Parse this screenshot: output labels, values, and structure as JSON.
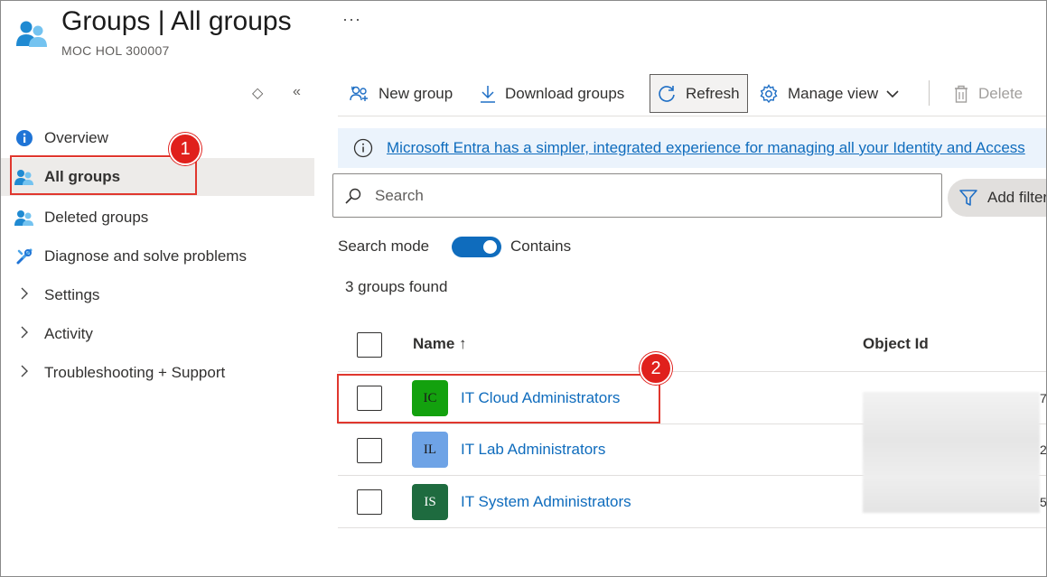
{
  "header": {
    "title": "Groups | All groups",
    "subtitle": "MOC HOL 300007",
    "more": "···",
    "icon": "groups-icon"
  },
  "sidebar": {
    "controls": {
      "expand": "◇",
      "collapse": "«"
    },
    "items": [
      {
        "label": "Overview",
        "icon": "info-icon"
      },
      {
        "label": "All groups",
        "icon": "groups-icon",
        "active": true
      },
      {
        "label": "Deleted groups",
        "icon": "groups-icon"
      },
      {
        "label": "Diagnose and solve problems",
        "icon": "wrench-icon"
      },
      {
        "label": "Settings",
        "icon": "chevron-right-icon"
      },
      {
        "label": "Activity",
        "icon": "chevron-right-icon"
      },
      {
        "label": "Troubleshooting + Support",
        "icon": "chevron-right-icon"
      }
    ]
  },
  "toolbar": {
    "new_group": "New group",
    "download_groups": "Download groups",
    "refresh": "Refresh",
    "manage_view": "Manage view",
    "delete": "Delete"
  },
  "banner": {
    "text": "Microsoft Entra has a simpler, integrated experience for managing all your Identity and Access"
  },
  "search": {
    "placeholder": "Search",
    "add_filter": "Add filter"
  },
  "search_mode": {
    "label": "Search mode",
    "value": "Contains",
    "enabled": true
  },
  "results": {
    "count_text": "3 groups found"
  },
  "table": {
    "columns": {
      "name": "Name ↑",
      "object_id": "Object Id"
    },
    "rows": [
      {
        "initials": "IC",
        "name": "IT Cloud Administrators",
        "avatar_color": "#13a10e",
        "id_edge": "7"
      },
      {
        "initials": "IL",
        "name": "IT Lab Administrators",
        "avatar_color": "#6ea3e6",
        "id_edge": "2"
      },
      {
        "initials": "IS",
        "name": "IT System Administrators",
        "avatar_color": "#1e6b3f",
        "id_edge": "5"
      }
    ]
  },
  "callouts": {
    "first": "1",
    "second": "2"
  },
  "colors": {
    "accent": "#0f6cbd",
    "callout": "#e0201c",
    "active_bg": "#edebe9"
  }
}
